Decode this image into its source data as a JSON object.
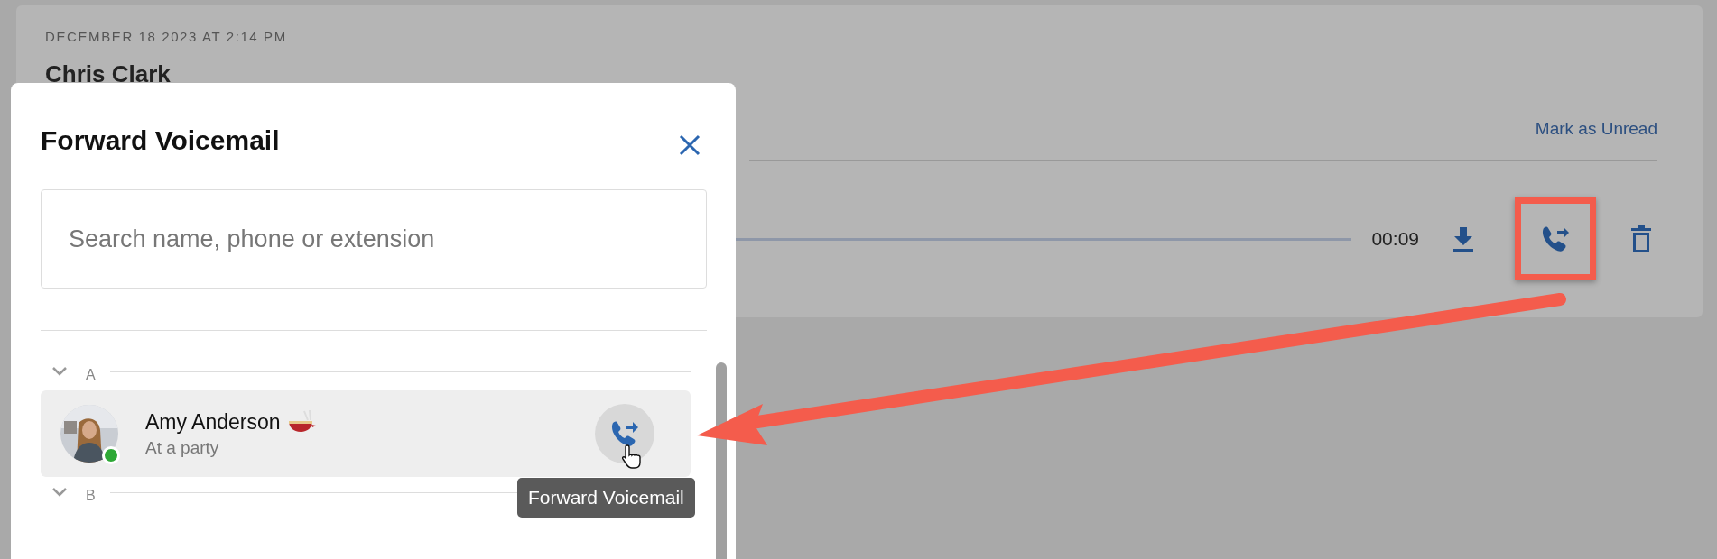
{
  "message": {
    "date": "DECEMBER 18 2023 AT 2:14 PM",
    "caller": "Chris Clark",
    "mark_unread": "Mark as Unread",
    "duration": "00:09"
  },
  "dialog": {
    "title": "Forward Voicemail",
    "search": {
      "placeholder": "Search name, phone or extension"
    },
    "groups": [
      {
        "letter": "A",
        "expanded": true,
        "contacts": [
          {
            "name": "Amy Anderson",
            "status": "At a party",
            "color": "#2ea836",
            "hovered": true,
            "tooltip": "Forward Voicemail"
          }
        ]
      },
      {
        "letter": "B",
        "expanded": true
      }
    ]
  }
}
